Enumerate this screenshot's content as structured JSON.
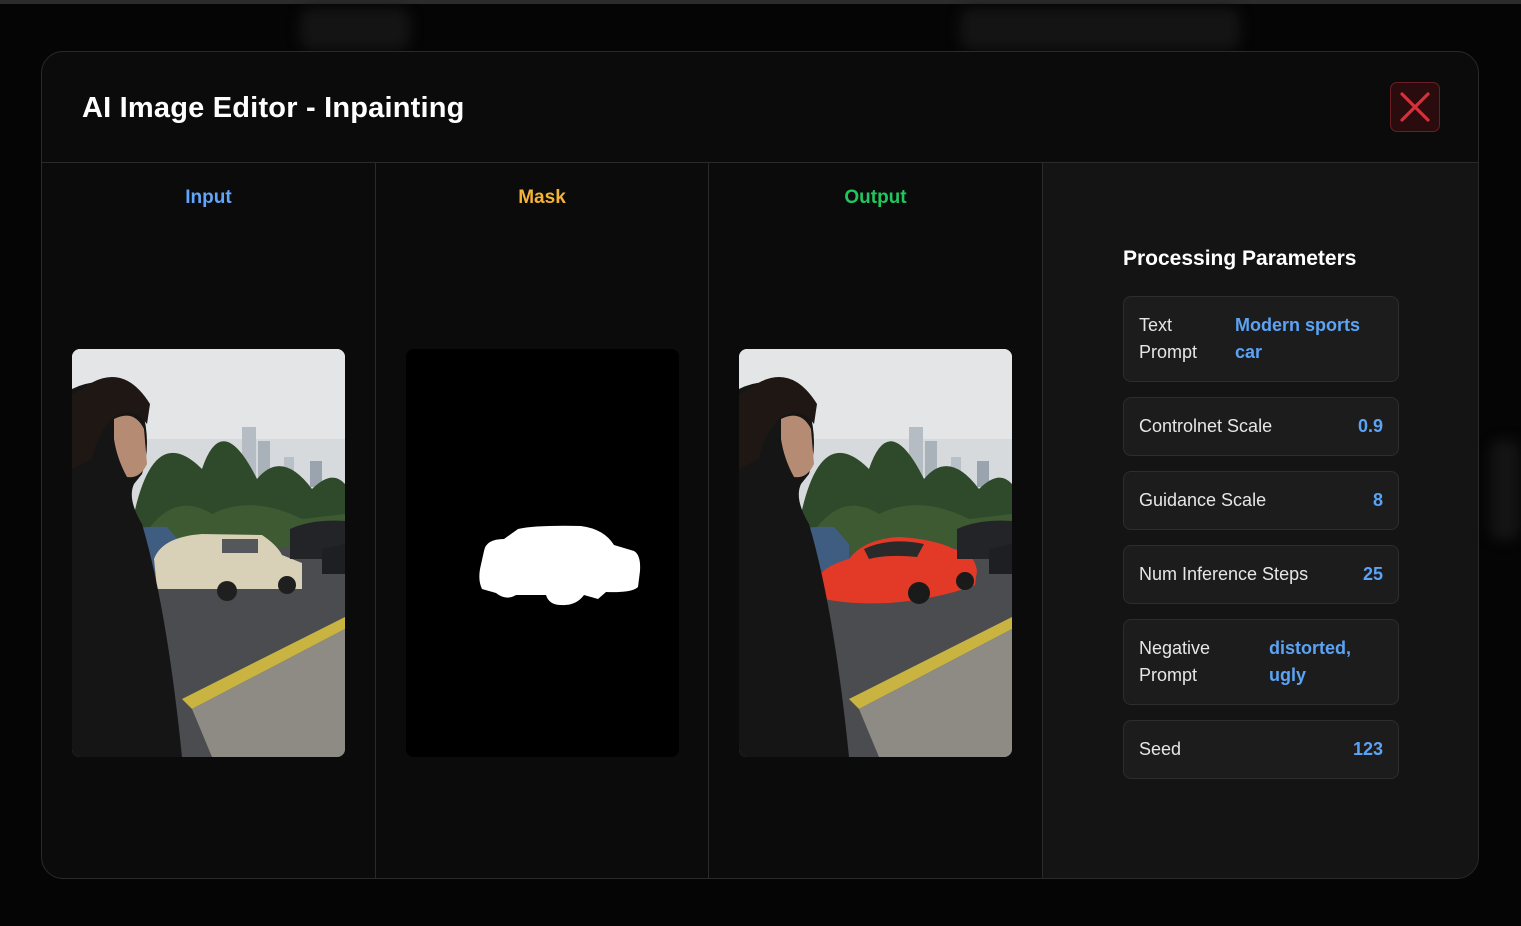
{
  "dialog": {
    "title": "AI Image Editor - Inpainting"
  },
  "panels": {
    "input_label": "Input",
    "mask_label": "Mask",
    "output_label": "Output"
  },
  "colors": {
    "input": "#60a5fa",
    "mask": "#f5b335",
    "output": "#22c55e",
    "value": "#5ba3f5",
    "close": "#d6303a"
  },
  "icons": {
    "close": "close-icon"
  },
  "parameters": {
    "heading": "Processing Parameters",
    "items": [
      {
        "label": "Text Prompt",
        "value": "Modern sports car"
      },
      {
        "label": "Controlnet Scale",
        "value": "0.9"
      },
      {
        "label": "Guidance Scale",
        "value": "8"
      },
      {
        "label": "Num Inference Steps",
        "value": "25"
      },
      {
        "label": "Negative Prompt",
        "value": "distorted, ugly"
      },
      {
        "label": "Seed",
        "value": "123"
      }
    ]
  }
}
